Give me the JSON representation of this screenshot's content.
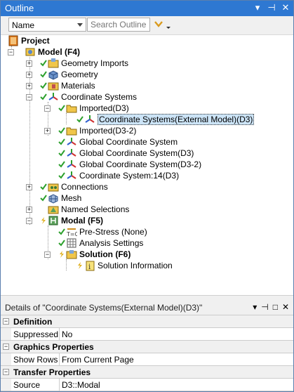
{
  "panel": {
    "title": "Outline"
  },
  "titlebar_buttons": [
    "▾",
    "⊣",
    "✕"
  ],
  "toolbar": {
    "name_select": "Name",
    "search_placeholder": "Search Outline"
  },
  "tree": [
    {
      "label": "Project",
      "bold": true
    },
    {
      "label": "Model (F4)",
      "bold": true
    },
    {
      "label": "Geometry Imports"
    },
    {
      "label": "Geometry"
    },
    {
      "label": "Materials"
    },
    {
      "label": "Coordinate Systems"
    },
    {
      "label": "Imported(D3)"
    },
    {
      "label": "Coordinate Systems(External Model)(D3)",
      "selected": true
    },
    {
      "label": "Imported(D3-2)"
    },
    {
      "label": "Global Coordinate System"
    },
    {
      "label": "Global Coordinate System(D3)"
    },
    {
      "label": "Global Coordinate System(D3-2)"
    },
    {
      "label": "Coordinate System:14(D3)"
    },
    {
      "label": "Connections"
    },
    {
      "label": "Mesh"
    },
    {
      "label": "Named Selections"
    },
    {
      "label": "Modal (F5)",
      "bold": true
    },
    {
      "label": "Pre-Stress (None)"
    },
    {
      "label": "Analysis Settings"
    },
    {
      "label": "Solution (F6)",
      "bold": true
    },
    {
      "label": "Solution Information"
    }
  ],
  "details": {
    "title": "Details of \"Coordinate Systems(External Model)(D3)\"",
    "buttons": [
      "▾",
      "⊣",
      "□",
      "✕"
    ],
    "groups": [
      {
        "category": "Definition",
        "rows": [
          {
            "key": "Suppressed",
            "value": "No"
          }
        ]
      },
      {
        "category": "Graphics Properties",
        "rows": [
          {
            "key": "Show Rows",
            "value": "From Current Page"
          }
        ]
      },
      {
        "category": "Transfer Properties",
        "rows": [
          {
            "key": "Source",
            "value": "D3::Modal"
          }
        ]
      }
    ]
  },
  "colors": {
    "titlebar": "#2e78d2",
    "check": "#2ca02c",
    "folder": "#f0c64a",
    "selection": "#cce4f7"
  }
}
